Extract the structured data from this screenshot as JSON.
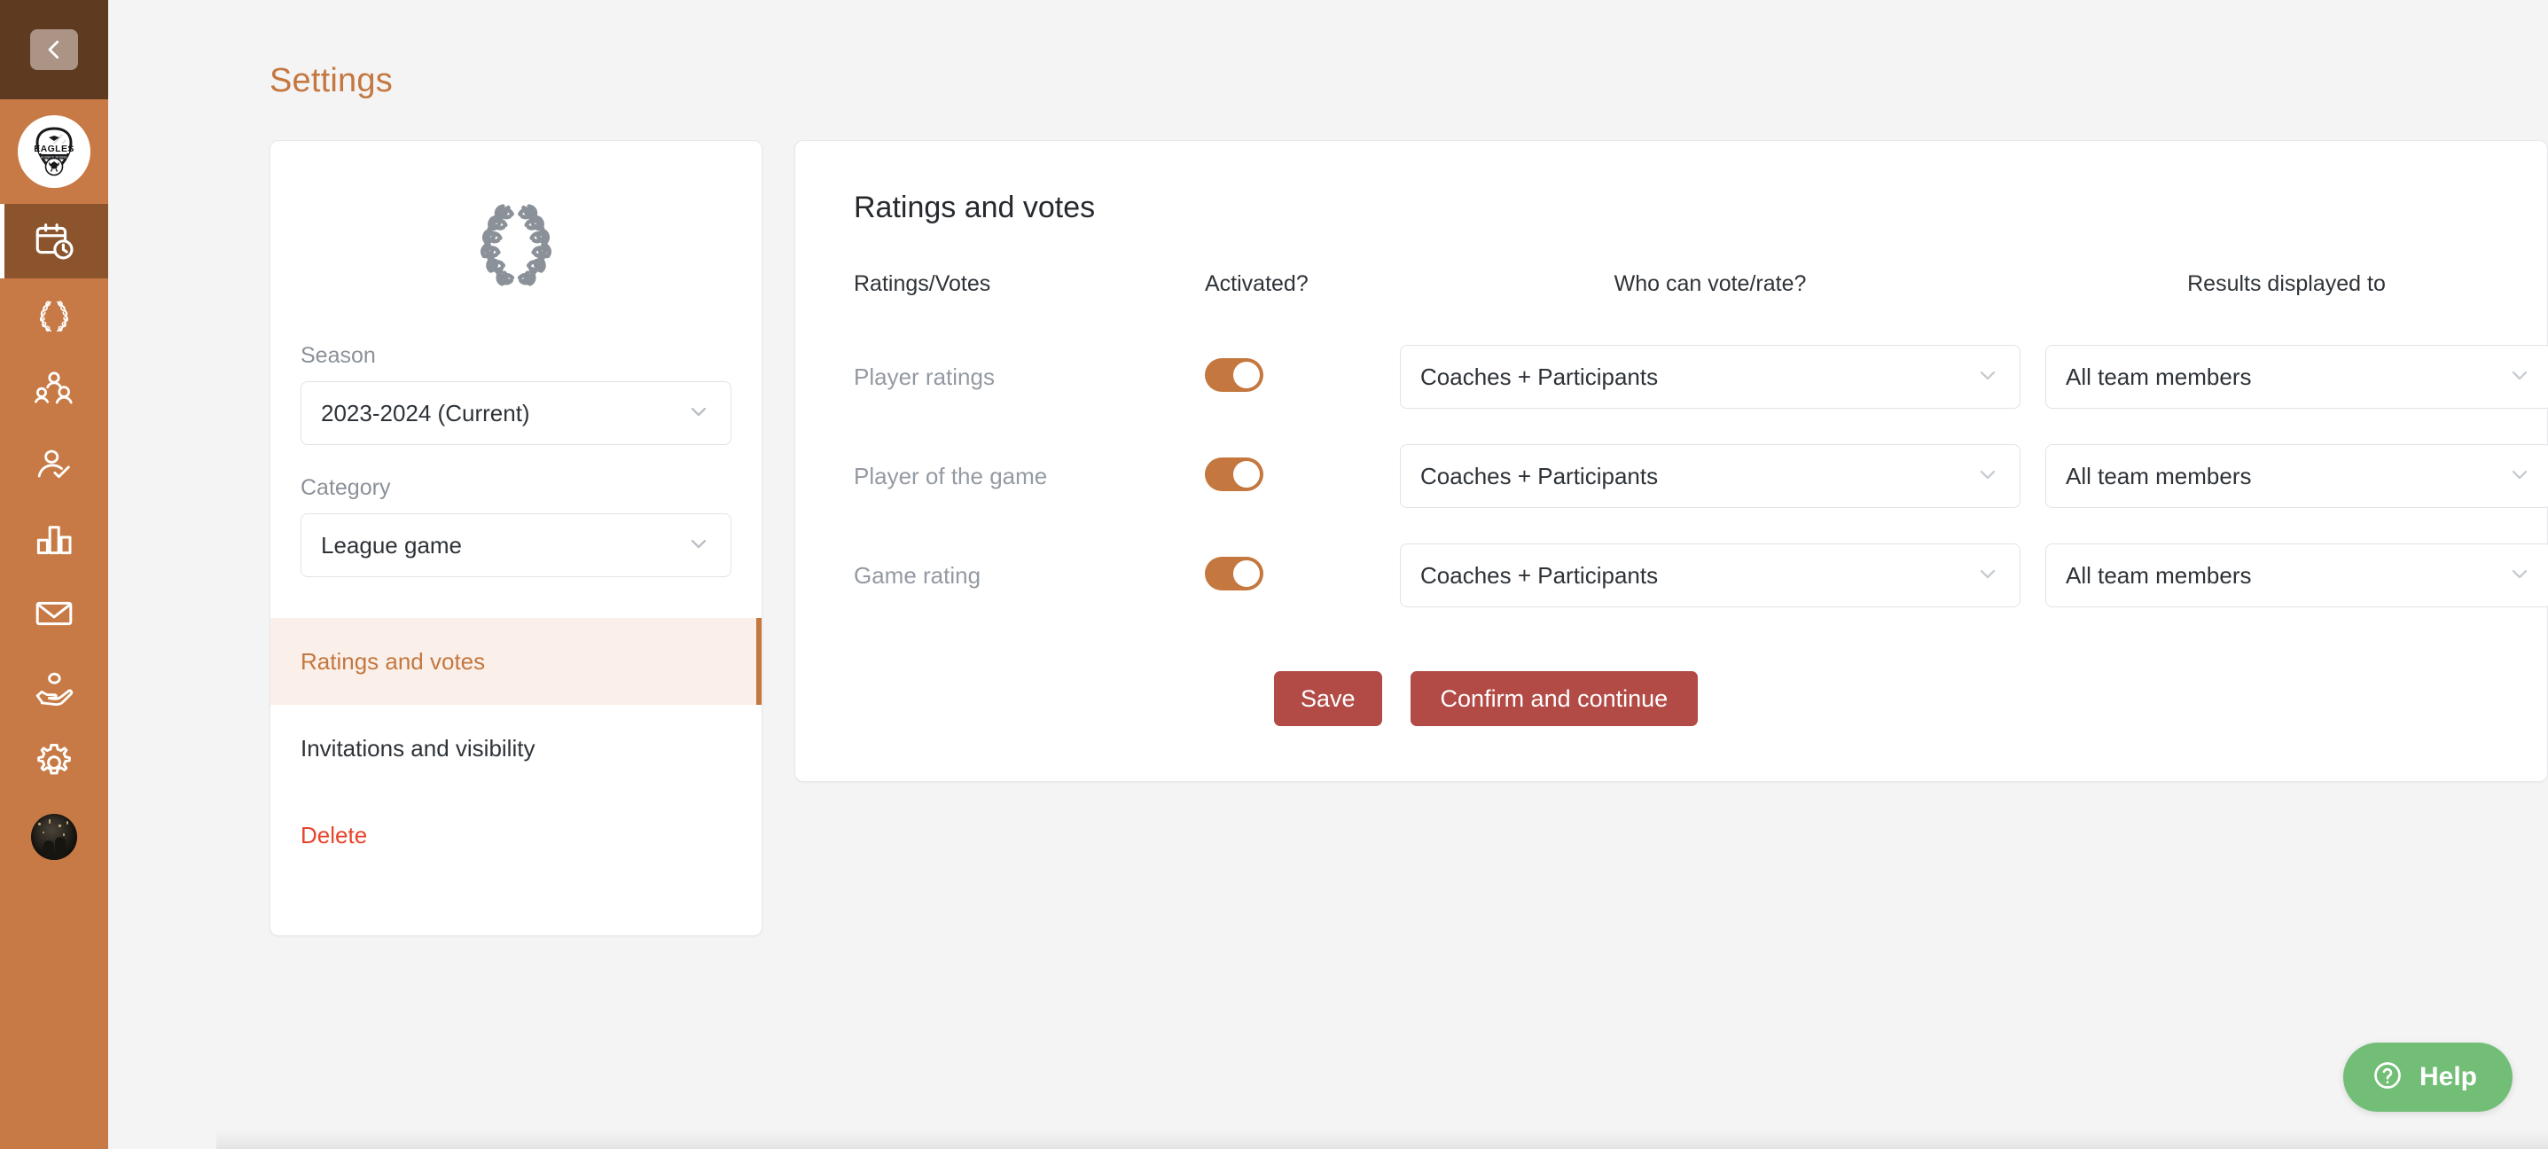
{
  "sidebar": {
    "collapse_icon": "chevron-left-icon",
    "logo": {
      "name": "team-logo",
      "primary_text": "EAGLES",
      "secondary_text": "ALWAYS RISING"
    },
    "items": [
      {
        "icon": "calendar-clock-icon",
        "name": "sidebar-item-schedule",
        "active": true
      },
      {
        "icon": "laurel-wreath-icon",
        "name": "sidebar-item-competitions",
        "active": false
      },
      {
        "icon": "group-people-icon",
        "name": "sidebar-item-teams",
        "active": false
      },
      {
        "icon": "person-check-icon",
        "name": "sidebar-item-attendance",
        "active": false
      },
      {
        "icon": "bar-chart-icon",
        "name": "sidebar-item-statistics",
        "active": false
      },
      {
        "icon": "envelope-icon",
        "name": "sidebar-item-messages",
        "active": false
      },
      {
        "icon": "hand-coin-icon",
        "name": "sidebar-item-payments",
        "active": false
      },
      {
        "icon": "gear-icon",
        "name": "sidebar-item-settings",
        "active": false
      }
    ],
    "avatar_name": "user-avatar"
  },
  "header": {
    "title": "Settings"
  },
  "left_panel": {
    "emblem_icon": "laurel-wreath-icon",
    "season": {
      "label": "Season",
      "value": "2023-2024 (Current)"
    },
    "category": {
      "label": "Category",
      "value": "League game"
    },
    "menu": [
      {
        "label": "Ratings and votes",
        "state": "active"
      },
      {
        "label": "Invitations and visibility",
        "state": "default"
      },
      {
        "label": "Delete",
        "state": "danger"
      }
    ]
  },
  "main_panel": {
    "title": "Ratings and votes",
    "columns": {
      "name": "Ratings/Votes",
      "activated": "Activated?",
      "who": "Who can vote/rate?",
      "results": "Results displayed to"
    },
    "rows": [
      {
        "label": "Player ratings",
        "activated": true,
        "who_value": "Coaches + Participants",
        "results_value": "All team members"
      },
      {
        "label": "Player of the game",
        "activated": true,
        "who_value": "Coaches + Participants",
        "results_value": "All team members"
      },
      {
        "label": "Game rating",
        "activated": true,
        "who_value": "Coaches + Participants",
        "results_value": "All team members"
      }
    ],
    "buttons": {
      "save": "Save",
      "confirm": "Confirm and continue"
    }
  },
  "help": {
    "label": "Help",
    "icon": "question-circle-icon"
  },
  "colors": {
    "brand_orange": "#c77a45",
    "sidebar_dark": "#5e3a20",
    "sidebar_active": "#8b542c",
    "title_orange": "#c4773f",
    "toggle_on": "#c4783f",
    "button_red": "#b24b46",
    "danger_red": "#e8442c",
    "help_green": "#72be76",
    "page_bg": "#f4f4f4",
    "menu_active_bg": "#fbf0e9"
  }
}
